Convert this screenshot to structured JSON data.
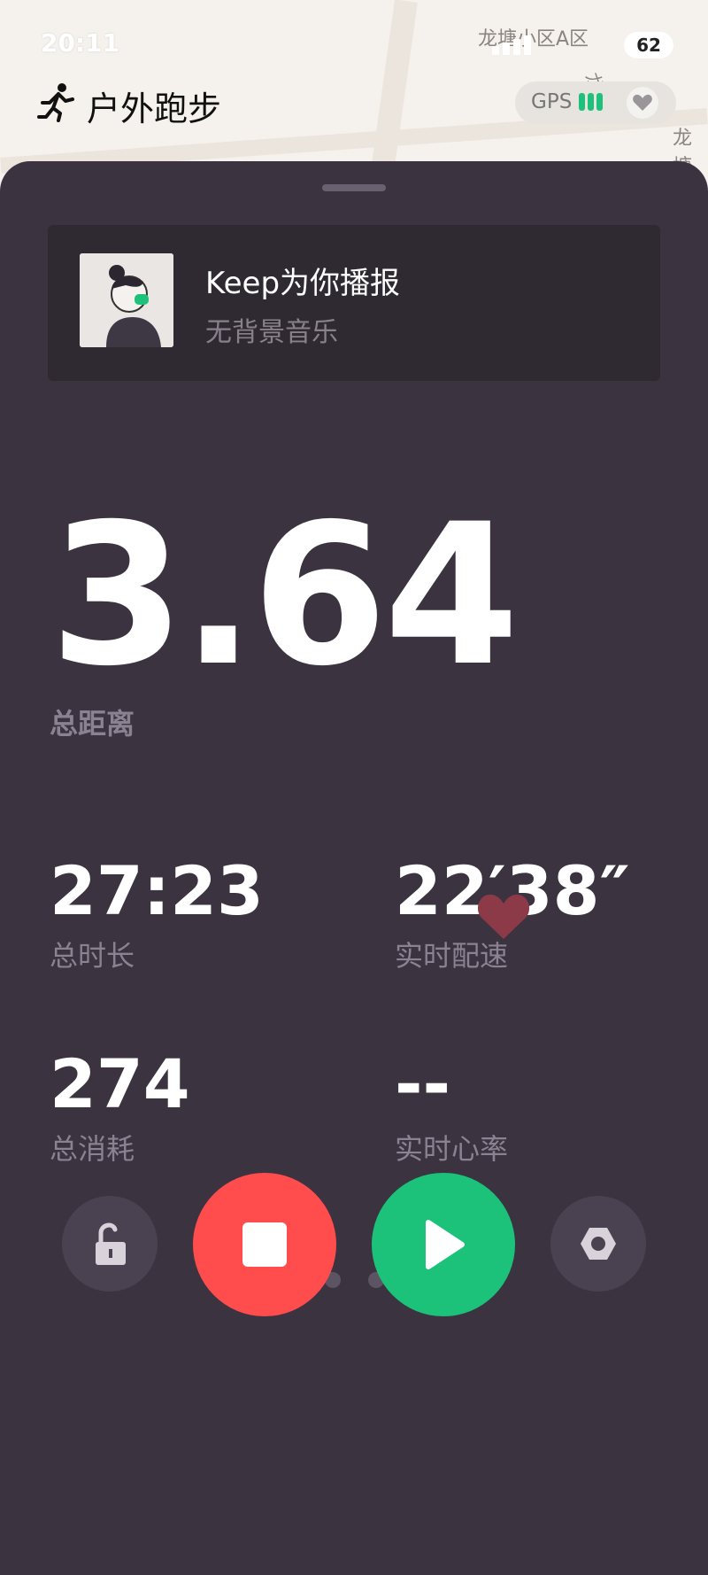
{
  "status_bar": {
    "time": "20:11",
    "battery": "62"
  },
  "map": {
    "labels": [
      "龙塘小区A区",
      "龙塘路",
      "龙塘"
    ]
  },
  "header": {
    "title": "户外跑步",
    "gps_label": "GPS"
  },
  "music": {
    "title": "Keep为你播报",
    "subtitle": "无背景音乐"
  },
  "distance": {
    "value": "3.64",
    "label": "总距离"
  },
  "stats": [
    {
      "value": "27:23",
      "label": "总时长"
    },
    {
      "value": "22′38″",
      "label": "实时配速"
    },
    {
      "value": "274",
      "label": "总消耗"
    },
    {
      "value": "--",
      "label": "实时心率"
    }
  ],
  "pager": {
    "count": 4,
    "active_index": 0
  },
  "icons": {
    "runner": "runner-icon",
    "heart": "heart-icon",
    "lock": "unlock-icon",
    "stop": "stop-icon",
    "play": "play-icon",
    "settings": "settings-icon"
  },
  "colors": {
    "panel": "#3b3340",
    "stop": "#ff4d4d",
    "play": "#1cc17a",
    "gps": "#1ec17b",
    "heart": "#8c3a47"
  }
}
